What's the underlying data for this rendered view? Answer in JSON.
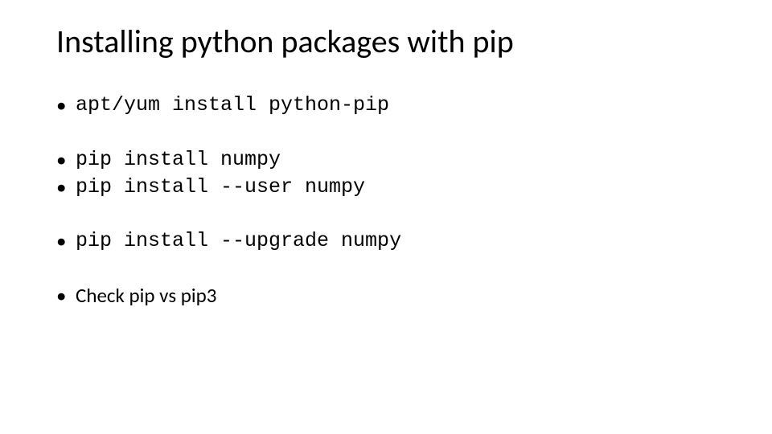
{
  "slide": {
    "title": "Installing python packages with pip",
    "bullets": [
      {
        "text": "apt/yum install python-pip",
        "mono": true
      },
      {
        "text": "pip install numpy",
        "mono": true
      },
      {
        "text": "pip install --user numpy",
        "mono": true
      },
      {
        "text": "pip install --upgrade numpy",
        "mono": true
      },
      {
        "text": "Check pip vs pip3",
        "mono": false
      }
    ]
  }
}
